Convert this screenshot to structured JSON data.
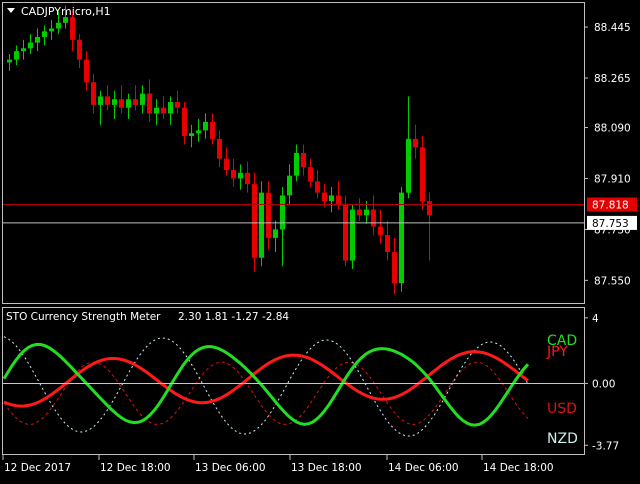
{
  "title": {
    "symbol_period": "CADJPYmicro,H1"
  },
  "colors": {
    "background": "#000000",
    "frame": "#c0c0c0",
    "bull": "#00cc00",
    "bear": "#e60000",
    "bid_line": "#b00000",
    "ask_line": "#c0c0c0",
    "cad": "#22dd22",
    "jpy": "#ff1a1a",
    "usd": "#dd1111",
    "nzd": "#ccf0f0"
  },
  "price_panel": {
    "price_labels": [
      "88.445",
      "88.265",
      "88.090",
      "87.910",
      "87.730",
      "87.550"
    ],
    "ylim": [
      87.47,
      88.53
    ],
    "bid": {
      "label": "87.818",
      "value": 87.818
    },
    "ask": {
      "label": "87.753",
      "value": 87.753
    }
  },
  "indicator_panel": {
    "header": "STO Currency Strength Meter",
    "values_text": "2.30  1.81  -1.27  -2.84",
    "ylim": [
      -4.3,
      4.6
    ],
    "scale_labels": [
      "4",
      "0.00",
      "-3.77"
    ],
    "zero_level": 0,
    "legend": [
      "CAD",
      "JPY",
      "USD",
      "NZD"
    ]
  },
  "time_axis": {
    "labels": [
      "12 Dec 2017",
      "12 Dec 18:00",
      "13 Dec 06:00",
      "13 Dec 18:00",
      "14 Dec 06:00",
      "14 Dec 18:00"
    ]
  },
  "chart_data": {
    "type": "candlestick",
    "symbol": "CADJPYmicro",
    "timeframe": "H1",
    "candles": [
      [
        88.32,
        88.35,
        88.29,
        88.33
      ],
      [
        88.33,
        88.38,
        88.31,
        88.36
      ],
      [
        88.36,
        88.4,
        88.33,
        88.37
      ],
      [
        88.37,
        88.42,
        88.35,
        88.39
      ],
      [
        88.39,
        88.44,
        88.36,
        88.41
      ],
      [
        88.41,
        88.45,
        88.38,
        88.43
      ],
      [
        88.43,
        88.47,
        88.4,
        88.44
      ],
      [
        88.44,
        88.5,
        88.42,
        88.46
      ],
      [
        88.46,
        88.52,
        88.44,
        88.48
      ],
      [
        88.48,
        88.5,
        88.36,
        88.4
      ],
      [
        88.4,
        88.42,
        88.3,
        88.33
      ],
      [
        88.33,
        88.36,
        88.22,
        88.25
      ],
      [
        88.25,
        88.28,
        88.14,
        88.17
      ],
      [
        88.17,
        88.22,
        88.1,
        88.2
      ],
      [
        88.2,
        88.24,
        88.15,
        88.17
      ],
      [
        88.17,
        88.22,
        88.12,
        88.19
      ],
      [
        88.19,
        88.24,
        88.14,
        88.16
      ],
      [
        88.16,
        88.21,
        88.12,
        88.19
      ],
      [
        88.19,
        88.24,
        88.15,
        88.17
      ],
      [
        88.17,
        88.24,
        88.14,
        88.21
      ],
      [
        88.21,
        88.26,
        88.11,
        88.14
      ],
      [
        88.14,
        88.19,
        88.1,
        88.16
      ],
      [
        88.16,
        88.2,
        88.12,
        88.14
      ],
      [
        88.14,
        88.2,
        88.1,
        88.18
      ],
      [
        88.18,
        88.22,
        88.14,
        88.16
      ],
      [
        88.16,
        88.18,
        88.03,
        88.06
      ],
      [
        88.06,
        88.1,
        88.02,
        88.07
      ],
      [
        88.07,
        88.12,
        88.04,
        88.08
      ],
      [
        88.08,
        88.14,
        88.05,
        88.11
      ],
      [
        88.11,
        88.14,
        88.03,
        88.05
      ],
      [
        88.05,
        88.08,
        87.95,
        87.98
      ],
      [
        87.98,
        88.02,
        87.92,
        87.94
      ],
      [
        87.94,
        87.98,
        87.88,
        87.91
      ],
      [
        87.91,
        87.96,
        87.87,
        87.93
      ],
      [
        87.93,
        87.97,
        87.86,
        87.89
      ],
      [
        87.89,
        87.93,
        87.58,
        87.63
      ],
      [
        87.63,
        87.9,
        87.6,
        87.86
      ],
      [
        87.86,
        87.9,
        87.66,
        87.7
      ],
      [
        87.7,
        87.76,
        87.65,
        87.73
      ],
      [
        87.73,
        87.88,
        87.6,
        87.85
      ],
      [
        87.85,
        87.96,
        87.82,
        87.92
      ],
      [
        87.92,
        88.03,
        87.9,
        88.0
      ],
      [
        88.0,
        88.03,
        87.92,
        87.95
      ],
      [
        87.95,
        87.98,
        87.88,
        87.9
      ],
      [
        87.9,
        87.94,
        87.84,
        87.86
      ],
      [
        87.86,
        87.89,
        87.81,
        87.83
      ],
      [
        87.83,
        87.88,
        87.79,
        87.85
      ],
      [
        87.85,
        87.9,
        87.8,
        87.82
      ],
      [
        87.82,
        87.85,
        87.6,
        87.62
      ],
      [
        87.62,
        87.82,
        87.59,
        87.8
      ],
      [
        87.8,
        87.84,
        87.76,
        87.78
      ],
      [
        87.78,
        87.83,
        87.75,
        87.8
      ],
      [
        87.8,
        87.85,
        87.71,
        87.74
      ],
      [
        87.74,
        87.8,
        87.68,
        87.71
      ],
      [
        87.71,
        87.76,
        87.62,
        87.65
      ],
      [
        87.65,
        87.7,
        87.5,
        87.54
      ],
      [
        87.54,
        87.88,
        87.51,
        87.86
      ],
      [
        87.86,
        88.2,
        87.84,
        88.05
      ],
      [
        88.05,
        88.1,
        87.98,
        88.02
      ],
      [
        88.02,
        88.06,
        87.8,
        87.83
      ],
      [
        87.83,
        87.86,
        87.62,
        87.78
      ]
    ],
    "bid": 87.818,
    "ask": 87.753
  }
}
